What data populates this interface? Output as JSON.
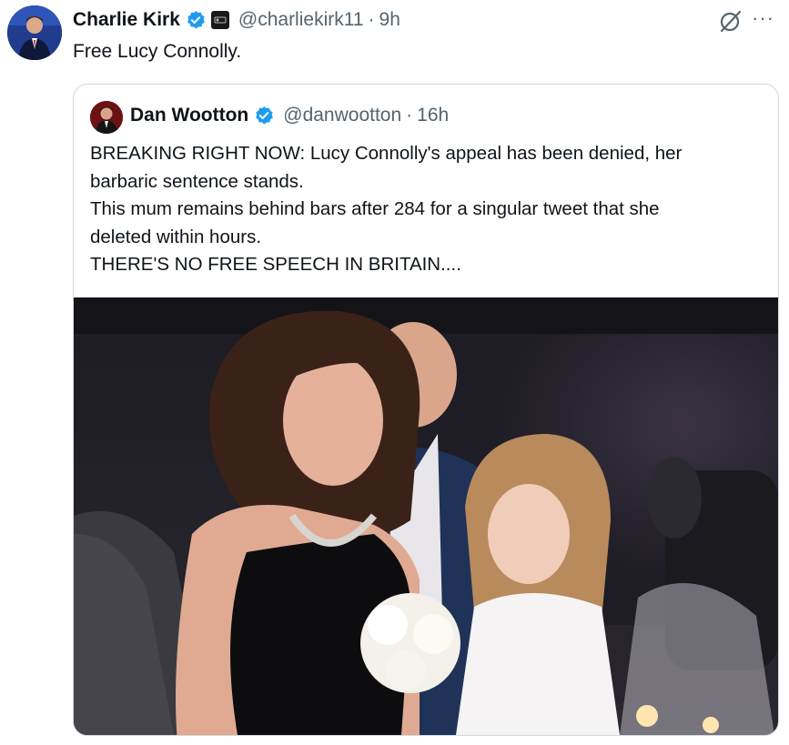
{
  "tweet": {
    "author_name": "Charlie Kirk",
    "handle": "@charliekirk11",
    "separator": "·",
    "time": "9h",
    "text": "Free Lucy Connolly.",
    "more_label": "···"
  },
  "quote": {
    "author_name": "Dan Wootton",
    "handle": "@danwootton",
    "separator": "·",
    "time": "16h",
    "lines": [
      "BREAKING RIGHT NOW: Lucy Connolly's appeal has been denied, her",
      "barbaric sentence stands.",
      "This mum remains behind bars after 284 for a singular tweet that she",
      "deleted within hours.",
      "THERE'S NO FREE SPEECH IN BRITAIN...."
    ]
  },
  "colors": {
    "verified_blue": "#1d9bf0",
    "secondary_text": "#536471",
    "border": "#cfd9de"
  },
  "icons": [
    "verified-badge-icon",
    "affiliate-badge-icon",
    "grok-icon",
    "more-icon"
  ]
}
